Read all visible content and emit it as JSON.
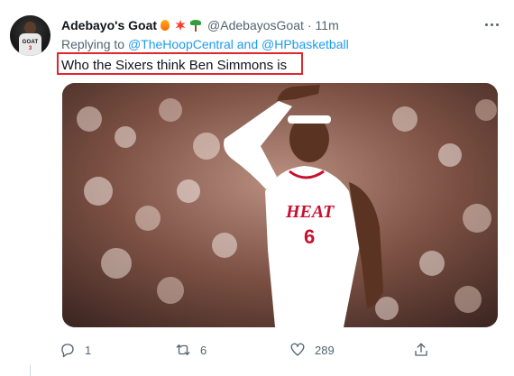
{
  "tweet": {
    "author": {
      "display_name": "Adebayo's Goat",
      "emojis": [
        "fire-emoji",
        "burst-emoji",
        "palm-tree-emoji"
      ],
      "handle": "@AdebayosGoat",
      "time": "11m",
      "avatar": {
        "jersey_text": "GOAT",
        "jersey_number": "3"
      }
    },
    "reply": {
      "prefix": "Replying to",
      "mention_1": "@TheHoopCentral",
      "conjunction": "and",
      "mention_2": "@HPbasketball"
    },
    "text": "Who the Sixers think Ben Simmons is",
    "media": {
      "jersey_word": "HEAT",
      "jersey_number": "6"
    },
    "actions": {
      "reply_count": "1",
      "retweet_count": "6",
      "like_count": "289"
    },
    "separator": "·"
  },
  "colors": {
    "link": "#1d9bf0",
    "secondary_text": "#536471",
    "highlight_border": "#e0262e"
  }
}
